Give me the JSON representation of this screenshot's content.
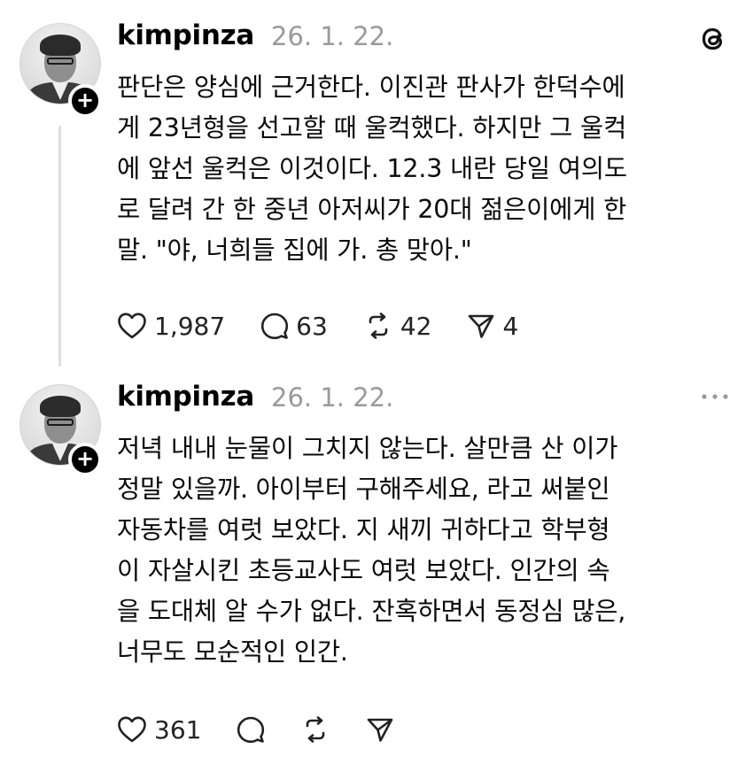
{
  "posts": [
    {
      "username": "kimpinza",
      "timestamp": "26. 1. 22.",
      "text": "판단은 양심에 근거한다. 이진관 판사가 한덕수에\n게 23년형을 선고할 때 울컥했다. 하지만 그 울컥\n에 앞선 울컥은 이것이다. 12.3 내란 당일 여의도\n로 달려 간 한 중년 아저씨가 20대 젊은이에게 한\n말. \"야, 너희들 집에 가. 총 맞아.\"",
      "likes": "1,987",
      "replies": "63",
      "reposts": "42",
      "shares": "4",
      "corner_icon": "threads-logo-icon"
    },
    {
      "username": "kimpinza",
      "timestamp": "26. 1. 22.",
      "text": "저녁 내내 눈물이 그치지 않는다. 살만큼 산 이가\n정말 있을까. 아이부터 구해주세요, 라고 써붙인\n자동차를 여럿 보았다. 지 새끼 귀하다고 학부형\n이 자살시킨 초등교사도 여럿 보았다. 인간의 속\n을 도대체 알 수가 없다. 잔혹하면서 동정심 많은,\n너무도 모순적인 인간.",
      "likes": "361",
      "corner_icon": "more-horizontal-icon"
    }
  ],
  "colors": {
    "text": "#0a0a0a",
    "muted": "#9a9a9a",
    "background": "#ffffff",
    "thread_line": "#dedede"
  }
}
